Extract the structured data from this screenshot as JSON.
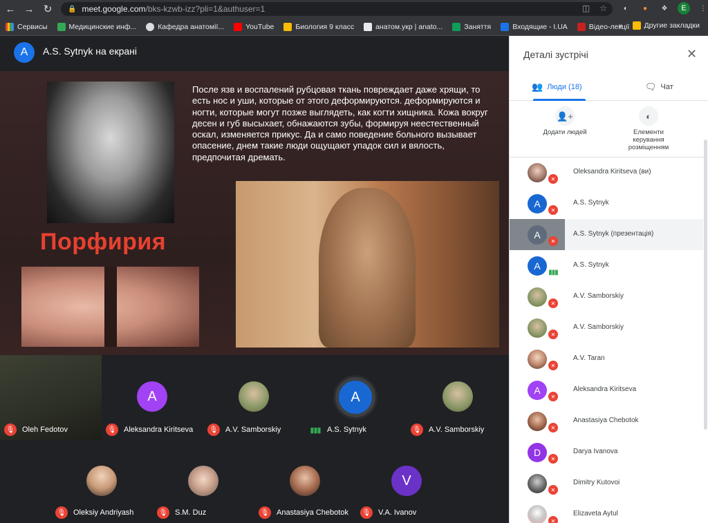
{
  "browser": {
    "url_host": "meet.google.com",
    "url_path": "/bks-kzwb-izz?pli=1&authuser=1",
    "profile_initial": "E",
    "bookmarks": [
      "Сервисы",
      "Медицинские инф...",
      "Кафедра анатомії...",
      "YouTube",
      "Биология 9 класс",
      "анатом.укр | anato...",
      "Заняття",
      "Входящие - I.UA",
      "Відео-лекції"
    ],
    "more_bookmarks": "»",
    "other_bookmarks": "Другие закладки"
  },
  "presenter": {
    "initial": "A",
    "label": "A.S. Sytnyk на екрані"
  },
  "slide": {
    "title": "Порфирия",
    "text": "После язв и воспалений рубцовая ткань повреждает даже хрящи, то есть нос и уши, которые от этого деформируются. деформируются и ногти, которые могут позже выглядеть, как когти хищника. Кожа вокруг десен и губ высыхает, обнажаются зубы, формируя неестественный оскал, изменяется прикус. Да и само поведение больного вызывает опасение, днем такие люди ощущают упадок сил и вялость, предпочитая дремать."
  },
  "tiles": [
    {
      "name": "Oleh Fedotov",
      "initial": "",
      "mic": "off"
    },
    {
      "name": "Aleksandra Kiritseva",
      "initial": "A",
      "mic": "off",
      "color": "#a142f4"
    },
    {
      "name": "A.V. Samborskiy",
      "initial": "",
      "mic": "off"
    },
    {
      "name": "A.S. Sytnyk",
      "initial": "A",
      "mic": "on",
      "color": "#1967d2"
    },
    {
      "name": "A.V. Samborskiy",
      "initial": "",
      "mic": "off"
    },
    {
      "name": "Oleksiy Andriyash",
      "initial": "",
      "mic": "off"
    },
    {
      "name": "S.M. Duz",
      "initial": "",
      "mic": "off"
    },
    {
      "name": "Anastasiya Chebotok",
      "initial": "",
      "mic": "off"
    },
    {
      "name": "V.A. Ivanov",
      "initial": "V",
      "mic": "off",
      "color": "#6b32c8"
    }
  ],
  "panel": {
    "title": "Деталі зустрічі",
    "tab_people": "Люди (18)",
    "tab_chat": "Чат",
    "add_people": "Додати людей",
    "host_controls": "Елементи керування розміщенням",
    "people": [
      {
        "name": "Oleksandra Kiritseva (ви)",
        "initial": "",
        "mic": "off"
      },
      {
        "name": "A.S. Sytnyk",
        "initial": "A",
        "mic": "off",
        "color": "#1967d2"
      },
      {
        "name": "A.S. Sytnyk (презентація)",
        "initial": "A",
        "mic": "off",
        "color": "#5f6b7a"
      },
      {
        "name": "A.S. Sytnyk",
        "initial": "A",
        "mic": "on",
        "color": "#1967d2"
      },
      {
        "name": "A.V. Samborskiy",
        "initial": "",
        "mic": "off"
      },
      {
        "name": "A.V. Samborskiy",
        "initial": "",
        "mic": "off"
      },
      {
        "name": "A.V. Taran",
        "initial": "",
        "mic": "off"
      },
      {
        "name": "Aleksandra Kiritseva",
        "initial": "A",
        "mic": "off",
        "color": "#a142f4"
      },
      {
        "name": "Anastasiya Chebotok",
        "initial": "",
        "mic": "off"
      },
      {
        "name": "Darya Ivanova",
        "initial": "D",
        "mic": "off",
        "color": "#9334e6"
      },
      {
        "name": "Dimitry Kutovoi",
        "initial": "",
        "mic": "off"
      },
      {
        "name": "Elizaveta Aytul",
        "initial": "",
        "mic": "off"
      }
    ]
  }
}
